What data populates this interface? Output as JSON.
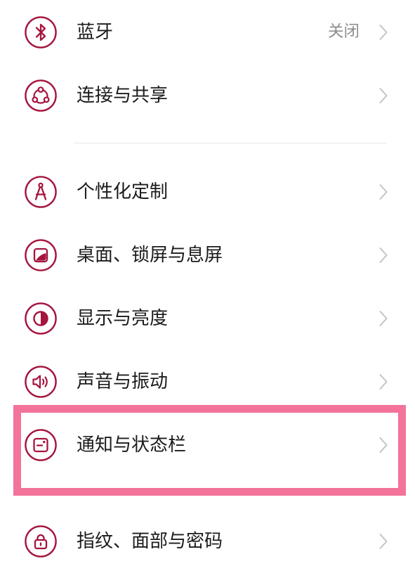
{
  "theme": {
    "accent_color": "#A5143E",
    "text_color": "#1B1B1B",
    "secondary_text_color": "#8E8E8E",
    "chevron_color": "#C4C4C4",
    "divider_color": "#E8E8E8",
    "highlight_color": "#F3739B",
    "background_color": "#FFFFFF"
  },
  "settings": {
    "chevron_icon": "chevron-right-icon",
    "groups": [
      {
        "items": [
          {
            "icon": "bluetooth-icon",
            "label": "蓝牙",
            "value": "关闭"
          },
          {
            "icon": "share-icon",
            "label": "连接与共享"
          }
        ]
      },
      {
        "items": [
          {
            "icon": "compass-icon",
            "label": "个性化定制"
          },
          {
            "icon": "wallpaper-icon",
            "label": "桌面、锁屏与息屏"
          },
          {
            "icon": "display-brightness-icon",
            "label": "显示与亮度"
          },
          {
            "icon": "speaker-icon",
            "label": "声音与振动"
          },
          {
            "icon": "notification-icon",
            "label": "通知与状态栏",
            "highlighted": true
          }
        ]
      },
      {
        "items": [
          {
            "icon": "lock-icon",
            "label": "指纹、面部与密码"
          }
        ]
      }
    ]
  }
}
